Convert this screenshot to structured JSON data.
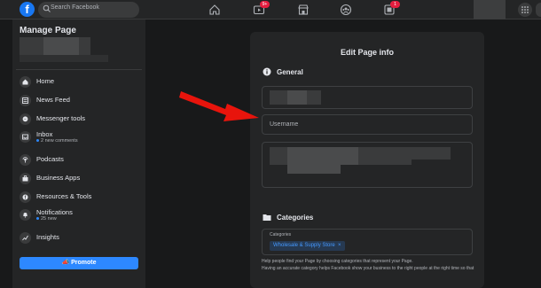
{
  "topbar": {
    "logo_letter": "f",
    "search_placeholder": "Search Facebook",
    "video_badge": "9+",
    "notif_badge": "1"
  },
  "sidebar": {
    "title": "Manage Page",
    "items": [
      {
        "label": "Home",
        "icon": "home-icon"
      },
      {
        "label": "News Feed",
        "icon": "news-feed-icon"
      },
      {
        "label": "Messenger tools",
        "icon": "messenger-icon"
      },
      {
        "label": "Inbox",
        "sub": "2 new comments",
        "icon": "inbox-icon"
      },
      {
        "label": "Podcasts",
        "icon": "podcast-icon"
      },
      {
        "label": "Business Apps",
        "icon": "business-apps-icon"
      },
      {
        "label": "Resources & Tools",
        "icon": "resources-icon"
      },
      {
        "label": "Notifications",
        "sub": "25 new",
        "icon": "bell-icon"
      },
      {
        "label": "Insights",
        "icon": "insights-icon"
      }
    ],
    "promote_label": "Promote"
  },
  "panel": {
    "title": "Edit Page info",
    "general_heading": "General",
    "username_placeholder": "Username",
    "categories_heading": "Categories",
    "categories_label": "Categories",
    "category_chip": "Wholesale & Supply Store",
    "chip_remove": "×",
    "help1": "Help people find your Page by choosing categories that represent your Page.",
    "help2": "Having an accurate category helps Facebook show your business to the right people at the right time so that"
  },
  "colors": {
    "background": "#18191a",
    "surface": "#242526",
    "accent": "#2d88ff",
    "arrow": "#e8140c"
  }
}
